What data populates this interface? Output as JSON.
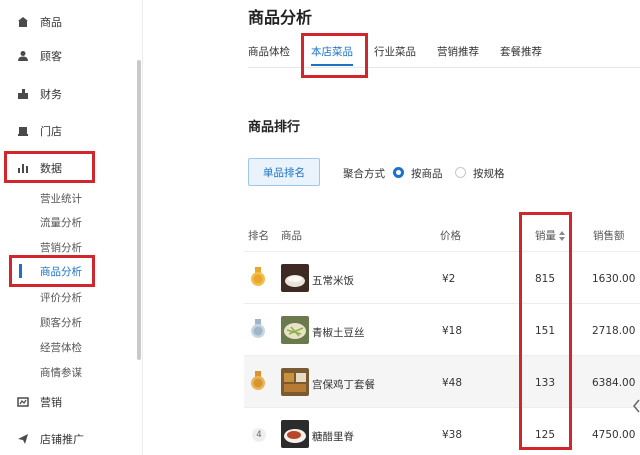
{
  "sidebar": {
    "items": [
      {
        "label": "商品",
        "icon": "shop-icon"
      },
      {
        "label": "顾客",
        "icon": "user-icon"
      },
      {
        "label": "财务",
        "icon": "wallet-icon"
      },
      {
        "label": "门店",
        "icon": "store-icon"
      },
      {
        "label": "数据",
        "icon": "bar-chart-icon"
      },
      {
        "label": "营销",
        "icon": "marketing-icon"
      },
      {
        "label": "店铺推广",
        "icon": "send-icon"
      }
    ],
    "data_sub_items": [
      "营业统计",
      "流量分析",
      "营销分析",
      "商品分析",
      "评价分析",
      "顾客分析",
      "经营体检",
      "商情参谋"
    ],
    "active_sub_item": "商品分析"
  },
  "main": {
    "title": "商品分析",
    "tabs": [
      "商品体检",
      "本店菜品",
      "行业菜品",
      "营销推荐",
      "套餐推荐"
    ],
    "active_tab": "本店菜品",
    "section_title": "商品排行",
    "rank_button": "单品排名",
    "aggregation": {
      "label": "聚合方式",
      "options": [
        "按商品",
        "按规格"
      ],
      "selected": "按商品"
    }
  },
  "table": {
    "headers": {
      "rank": "排名",
      "product": "商品",
      "price": "价格",
      "sales": "销量",
      "revenue": "销售额"
    },
    "rows": [
      {
        "rank": "1",
        "name": "五常米饭",
        "price": "¥2",
        "sales": "815",
        "revenue": "1630.00"
      },
      {
        "rank": "2",
        "name": "青椒土豆丝",
        "price": "¥18",
        "sales": "151",
        "revenue": "2718.00"
      },
      {
        "rank": "3",
        "name": "宫保鸡丁套餐",
        "price": "¥48",
        "sales": "133",
        "revenue": "6384.00"
      },
      {
        "rank": "4",
        "name": "糖醋里脊",
        "price": "¥38",
        "sales": "125",
        "revenue": "4750.00"
      }
    ]
  },
  "colors": {
    "accent": "#1a73c9",
    "annotation": "#d1262b",
    "gold": "#e9a62a",
    "silver": "#9fb6c8",
    "bronze": "#d9952d"
  }
}
